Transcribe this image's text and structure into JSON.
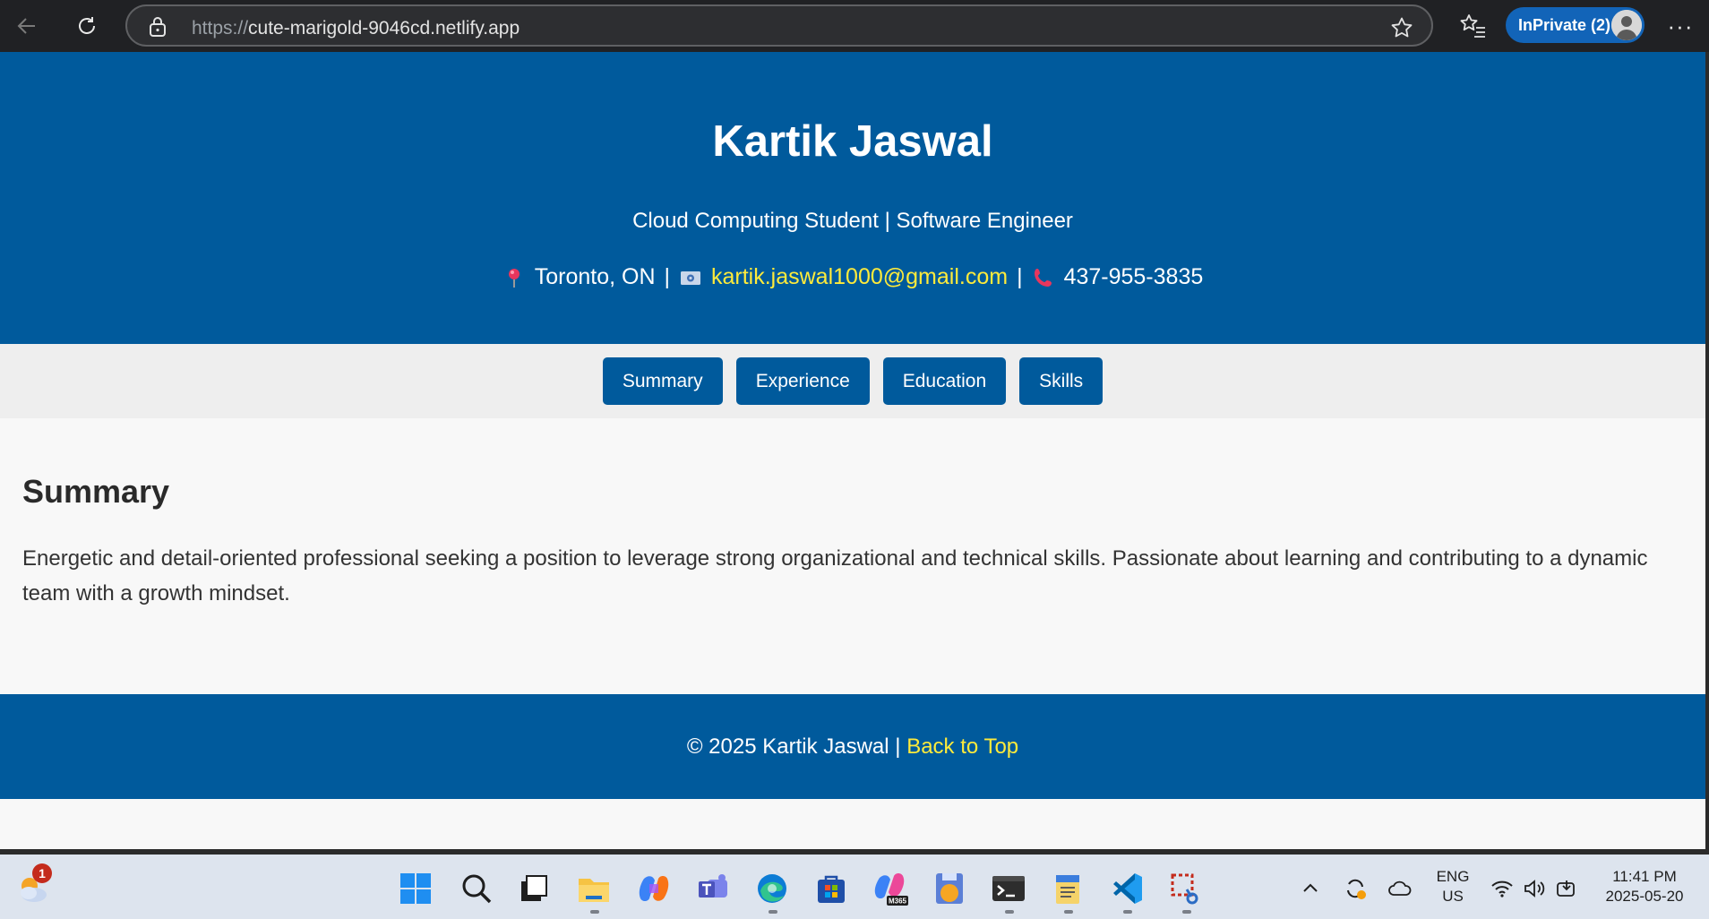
{
  "browser": {
    "url_protocol": "https://",
    "url_host": "cute-marigold-9046cd.netlify.app",
    "inprivate_label": "InPrivate (2)",
    "more_label": "···"
  },
  "header": {
    "name": "Kartik Jaswal",
    "role": "Cloud Computing Student | Software Engineer",
    "location": "Toronto, ON",
    "email": "kartik.jaswal1000@gmail.com",
    "phone": "437-955-3835",
    "separator": "|"
  },
  "nav": {
    "items": [
      {
        "label": "Summary"
      },
      {
        "label": "Experience"
      },
      {
        "label": "Education"
      },
      {
        "label": "Skills"
      }
    ]
  },
  "summary": {
    "heading": "Summary",
    "text": "Energetic and detail-oriented professional seeking a position to leverage strong organizational and technical skills. Passionate about learning and contributing to a dynamic team with a growth mindset."
  },
  "footer": {
    "copyright": "© 2025 Kartik Jaswal |",
    "back_to_top": "Back to Top"
  },
  "taskbar": {
    "weather_badge": "1",
    "lang_line1": "ENG",
    "lang_line2": "US",
    "time": "11:41 PM",
    "date": "2025-05-20",
    "m365_label": "M365"
  },
  "colors": {
    "brand_blue": "#005a9c",
    "link_yellow": "#ffeb3b",
    "page_bg": "#f8f8f8",
    "nav_bg": "#eeeeee"
  }
}
